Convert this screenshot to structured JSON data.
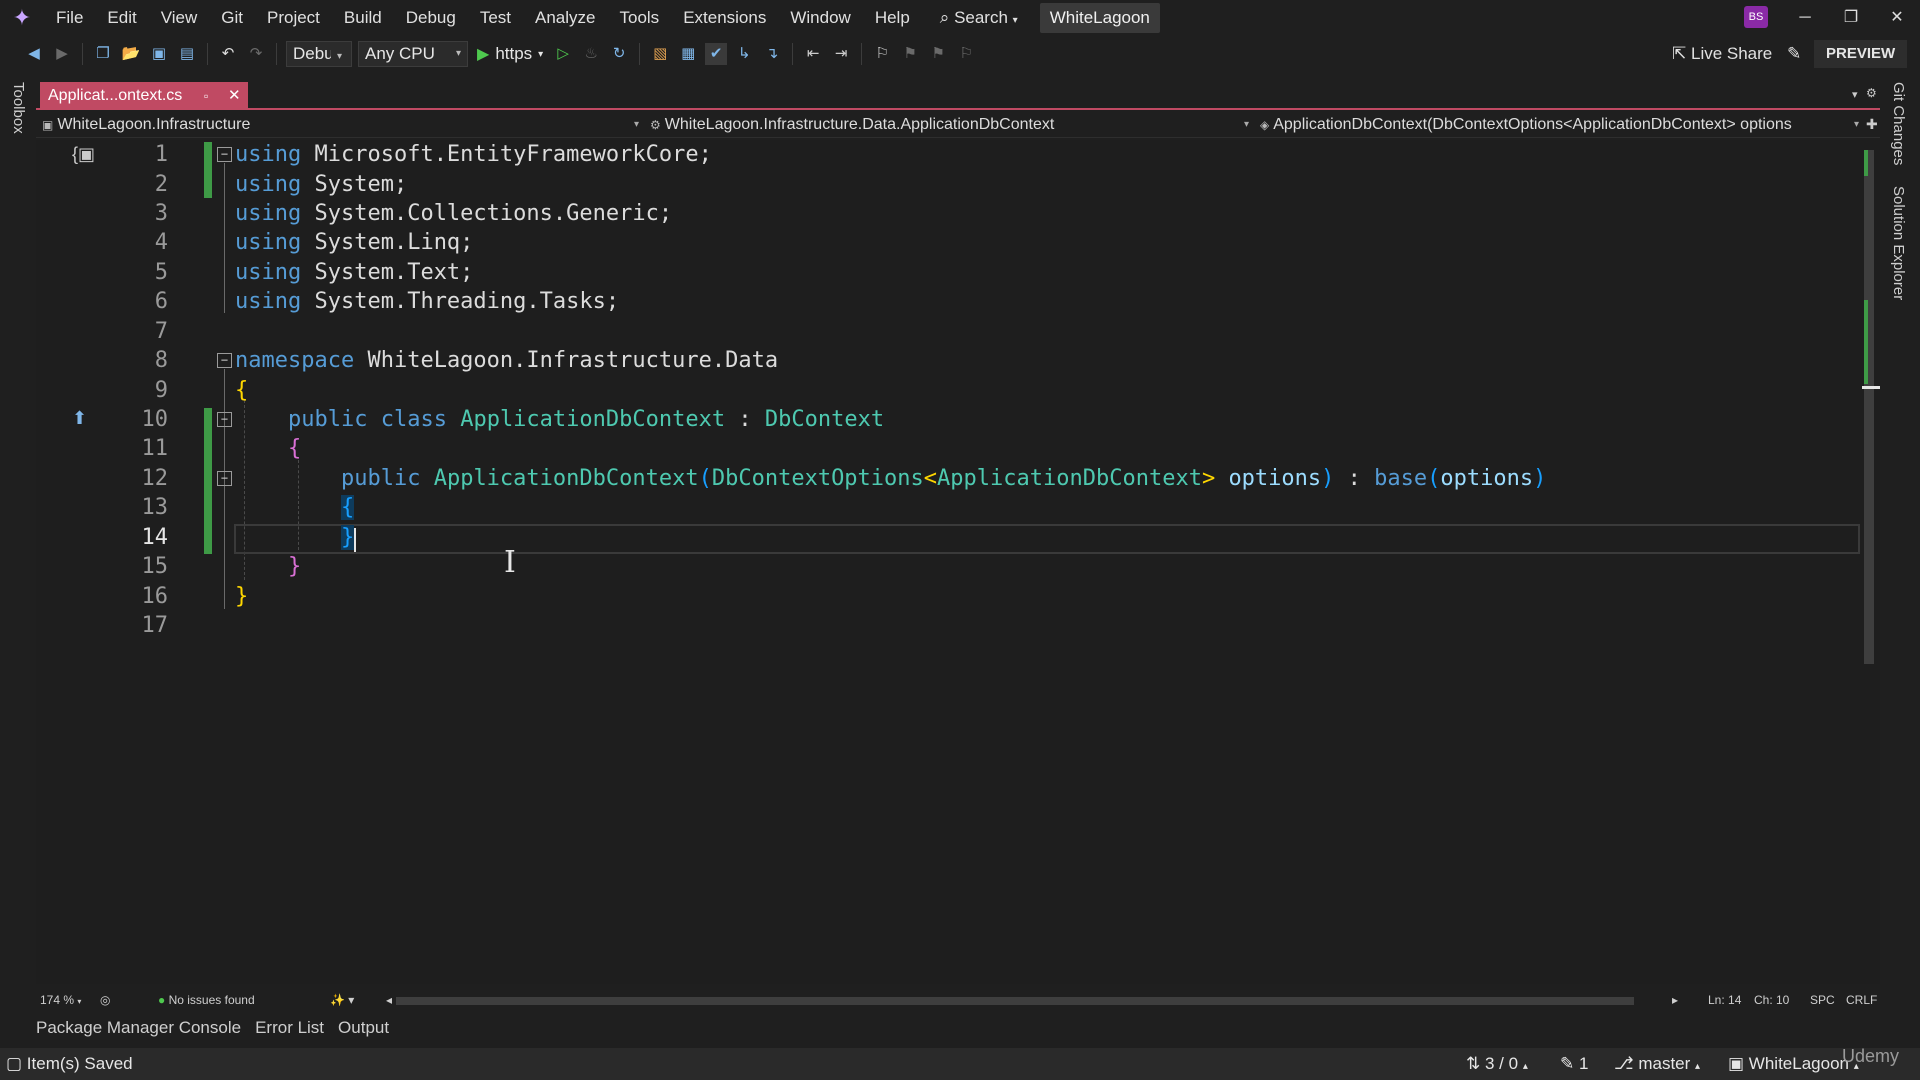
{
  "menubar": {
    "items": [
      "File",
      "Edit",
      "View",
      "Git",
      "Project",
      "Build",
      "Debug",
      "Test",
      "Analyze",
      "Tools",
      "Extensions",
      "Window",
      "Help"
    ],
    "search_label": "Search",
    "solution_name": "WhiteLagoon",
    "avatar_initials": "BS"
  },
  "toolbar": {
    "config_value": "Debug",
    "platform_value": "Any CPU",
    "run_label": "https",
    "live_share_label": "Live Share",
    "preview_label": "PREVIEW"
  },
  "side_panels": {
    "left": "Toolbox",
    "right_top": "Git Changes",
    "right_bottom": "Solution Explorer"
  },
  "tab": {
    "label": "Applicat...ontext.cs"
  },
  "navbar": {
    "project": "WhiteLagoon.Infrastructure",
    "type": "WhiteLagoon.Infrastructure.Data.ApplicationDbContext",
    "member": "ApplicationDbContext(DbContextOptions<ApplicationDbContext> options"
  },
  "editor": {
    "line_numbers": [
      "1",
      "2",
      "3",
      "4",
      "5",
      "6",
      "7",
      "8",
      "9",
      "10",
      "11",
      "12",
      "13",
      "14",
      "15",
      "16",
      "17"
    ],
    "current_line": 14,
    "code": {
      "l1_kw": "using",
      "l1_ns": "Microsoft.EntityFrameworkCore;",
      "l2_kw": "using",
      "l2_ns": "System;",
      "l3_kw": "using",
      "l3_ns": "System.Collections.Generic;",
      "l4_kw": "using",
      "l4_ns": "System.Linq;",
      "l5_kw": "using",
      "l5_ns": "System.Text;",
      "l6_kw": "using",
      "l6_ns": "System.Threading.Tasks;",
      "l8_kw": "namespace",
      "l8_ns": "WhiteLagoon.Infrastructure.Data",
      "open_brace": "{",
      "close_brace": "}",
      "l10_kw1": "public",
      "l10_kw2": "class",
      "l10_type": "ApplicationDbContext",
      "l10_colon": ":",
      "l10_base": "DbContext",
      "l12_kw": "public",
      "l12_ctor": "ApplicationDbContext",
      "l12_paren_open": "(",
      "l12_ptype": "DbContextOptions",
      "l12_lt": "<",
      "l12_targ": "ApplicationDbContext",
      "l12_gt": ">",
      "l12_pname": "options",
      "l12_paren_close": ")",
      "l12_colon": ":",
      "l12_base": "base",
      "l12_arg_open": "(",
      "l12_arg": "options",
      "l12_arg_close": ")"
    }
  },
  "editor_footer": {
    "zoom": "174 %",
    "issues": "No issues found",
    "line": "Ln: 14",
    "col": "Ch: 10",
    "whitespace": "SPC",
    "line_ending": "CRLF"
  },
  "tool_tabs": [
    "Package Manager Console",
    "Error List",
    "Output"
  ],
  "statusbar": {
    "message": "Item(s) Saved",
    "changes": "3 / 0",
    "pencil_count": "1",
    "branch": "master",
    "repo": "WhiteLagoon",
    "watermark": "Udemy"
  }
}
